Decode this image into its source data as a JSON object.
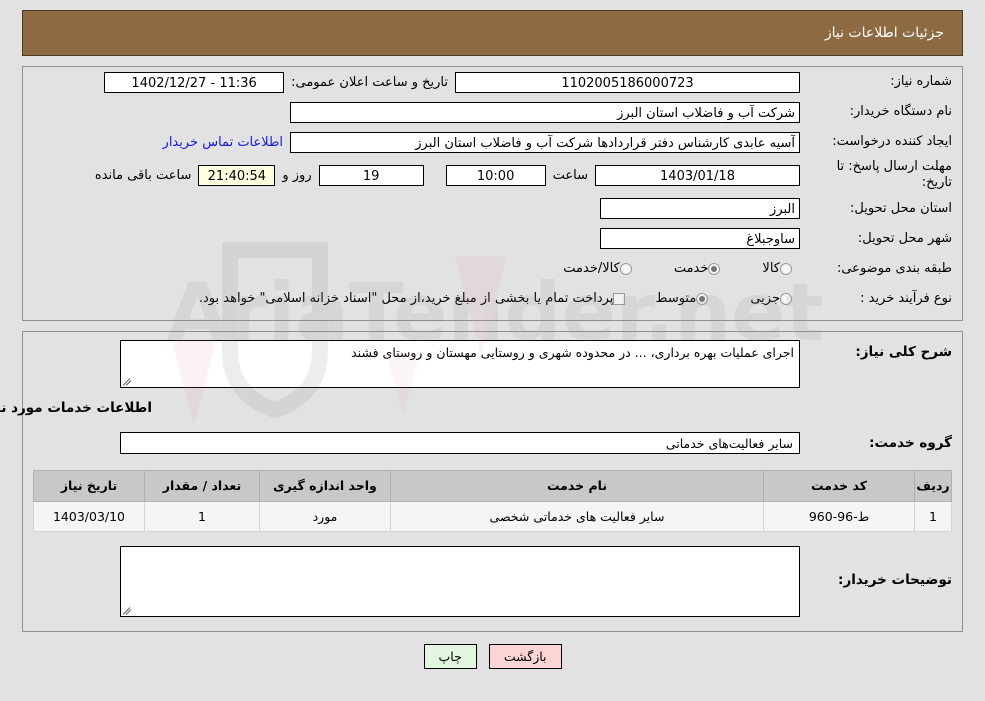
{
  "header": {
    "title": "جزئیات اطلاعات نیاز"
  },
  "colors": {
    "header_bg": "#8d6a42",
    "panel_bg": "#e2e2e2",
    "link": "#1818e0",
    "countdown_bg": "#ffffe0",
    "back_button_bg": "#fbd5d5",
    "print_button_bg": "#e3f7e0",
    "table_header_bg": "#c8c8c8"
  },
  "top_section": {
    "need_number": {
      "label": "شماره نیاز:",
      "value": "1102005186000723"
    },
    "announce_datetime": {
      "label": "تاریخ و ساعت اعلان عمومی:",
      "value": "11:36 - 1402/12/27"
    },
    "buyer_org": {
      "label": "نام دستگاه خریدار:",
      "value": "شرکت آب و فاضلاب استان البرز"
    },
    "request_creator": {
      "label": "ایجاد کننده درخواست:",
      "value": "آسیه عابدی کارشناس دفتر قراردادها شرکت آب و فاضلاب استان البرز",
      "contact_link": "اطلاعات تماس خریدار"
    },
    "deadline": {
      "label": "مهلت ارسال پاسخ: تا تاریخ:",
      "date": "1403/01/18",
      "hour_label": "ساعت",
      "hour": "10:00",
      "days": "19",
      "days_label": "روز و",
      "remaining": "21:40:54",
      "remaining_label": "ساعت باقی مانده"
    },
    "delivery_province": {
      "label": "استان محل تحویل:",
      "value": "البرز"
    },
    "delivery_city": {
      "label": "شهر محل تحویل:",
      "value": "ساوجبلاغ"
    },
    "subject_category": {
      "label": "طبقه بندی موضوعی:",
      "options": [
        {
          "label": "کالا",
          "checked": false
        },
        {
          "label": "خدمت",
          "checked": true
        },
        {
          "label": "کالا/خدمت",
          "checked": false
        }
      ]
    },
    "purchase_process": {
      "label": "نوع فرآیند خرید :",
      "options": [
        {
          "label": "جزیی",
          "checked": false
        },
        {
          "label": "متوسط",
          "checked": true
        }
      ],
      "treasury_note": "پرداخت تمام یا بخشی از مبلغ خرید،از محل \"اسناد خزانه اسلامی\" خواهد بود."
    }
  },
  "detail_section": {
    "general_description": {
      "label": "شرح کلی نیاز:",
      "value": "اجرای عملیات بهره برداری، ... در محدوده شهری و روستایی مهستان و روستای فشند"
    },
    "services_heading": "اطلاعات خدمات مورد نیاز",
    "service_group": {
      "label": "گروه خدمت:",
      "value": "سایر فعالیت‌های خدماتی"
    },
    "table": {
      "columns": [
        "ردیف",
        "کد خدمت",
        "نام خدمت",
        "واحد اندازه گیری",
        "تعداد / مقدار",
        "تاریخ نیاز"
      ],
      "rows": [
        {
          "radif": "1",
          "code": "ط-96-960",
          "name": "سایر فعالیت های خدماتی شخصی",
          "unit": "مورد",
          "qty": "1",
          "date": "1403/03/10"
        }
      ]
    },
    "buyer_notes": {
      "label": "توضیحات خریدار:",
      "value": ""
    }
  },
  "footer": {
    "back_button": "بازگشت",
    "print_button": "چاپ"
  },
  "watermark": {
    "text": "AriaTender.net"
  }
}
